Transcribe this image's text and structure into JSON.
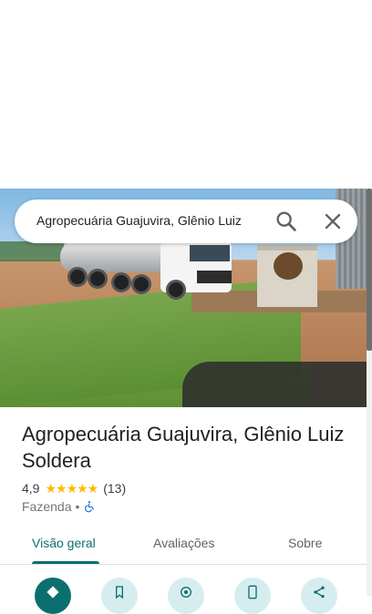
{
  "search": {
    "query": "Agropecuária Guajuvira, Glênio Luiz",
    "search_icon": "search-icon",
    "close_icon": "close-icon"
  },
  "place": {
    "title": "Agropecuária Guajuvira, Glênio Luiz Soldera",
    "rating": "4,9",
    "stars": "★★★★★",
    "rating_value": 4.9,
    "review_count": "(13)",
    "category": "Fazenda",
    "separator": "•",
    "accessibility_icon": "wheelchair-icon"
  },
  "tabs": [
    {
      "label": "Visão geral",
      "active": true
    },
    {
      "label": "Avaliações",
      "active": false
    },
    {
      "label": "Sobre",
      "active": false
    }
  ],
  "actions": [
    {
      "icon": "directions-icon"
    },
    {
      "icon": "save-bookmark-icon"
    },
    {
      "icon": "nearby-icon"
    },
    {
      "icon": "send-to-phone-icon"
    },
    {
      "icon": "share-icon"
    }
  ],
  "colors": {
    "accent": "#0b6f6f",
    "star": "#fbbc04",
    "action_secondary_bg": "#d6edf0",
    "text_primary": "#202124",
    "text_secondary": "#70757a"
  }
}
